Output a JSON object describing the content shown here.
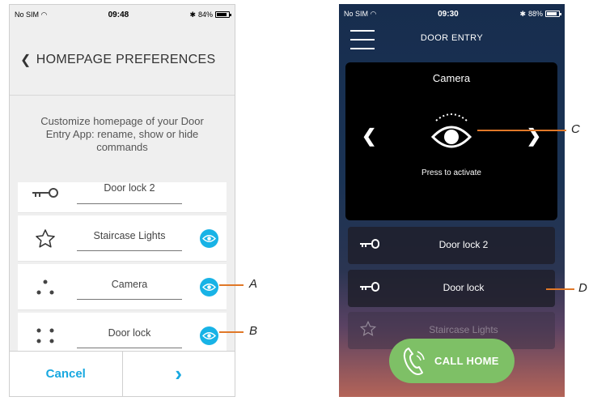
{
  "left_phone": {
    "status": {
      "carrier": "No SIM",
      "time": "09:48",
      "battery": "84%",
      "battery_level": 0.84
    },
    "header": {
      "back_glyph": "❮",
      "title": "HOMEPAGE PREFERENCES"
    },
    "description": "Customize homepage of your Door Entry App: rename, show or hide commands",
    "items": [
      {
        "label": "Door lock 2",
        "icon": "key-icon"
      },
      {
        "label": "Staircase Lights",
        "icon": "star-icon"
      },
      {
        "label": "Camera",
        "icon": "drag-dots-icon"
      },
      {
        "label": "Door lock",
        "icon": "drag-dots-icon"
      }
    ],
    "footer": {
      "cancel_label": "Cancel",
      "next_glyph": "›"
    }
  },
  "right_phone": {
    "status": {
      "carrier": "No SIM",
      "time": "09:30",
      "battery": "88%",
      "battery_level": 0.88
    },
    "title": "DOOR ENTRY",
    "camera": {
      "title": "Camera",
      "hint": "Press to activate",
      "prev_glyph": "❮",
      "next_glyph": "❯"
    },
    "doors": [
      {
        "label": "Door lock 2",
        "icon": "key-icon"
      },
      {
        "label": "Door lock",
        "icon": "key-icon"
      },
      {
        "label": "Staircase Lights",
        "icon": "star-icon"
      }
    ],
    "call_home": "CALL HOME"
  },
  "callouts": {
    "a": "A",
    "b": "B",
    "c": "C",
    "d": "D"
  },
  "colors": {
    "accent_blue": "#18b3e6",
    "callout_orange": "#e07828",
    "call_green": "#7ec066"
  }
}
